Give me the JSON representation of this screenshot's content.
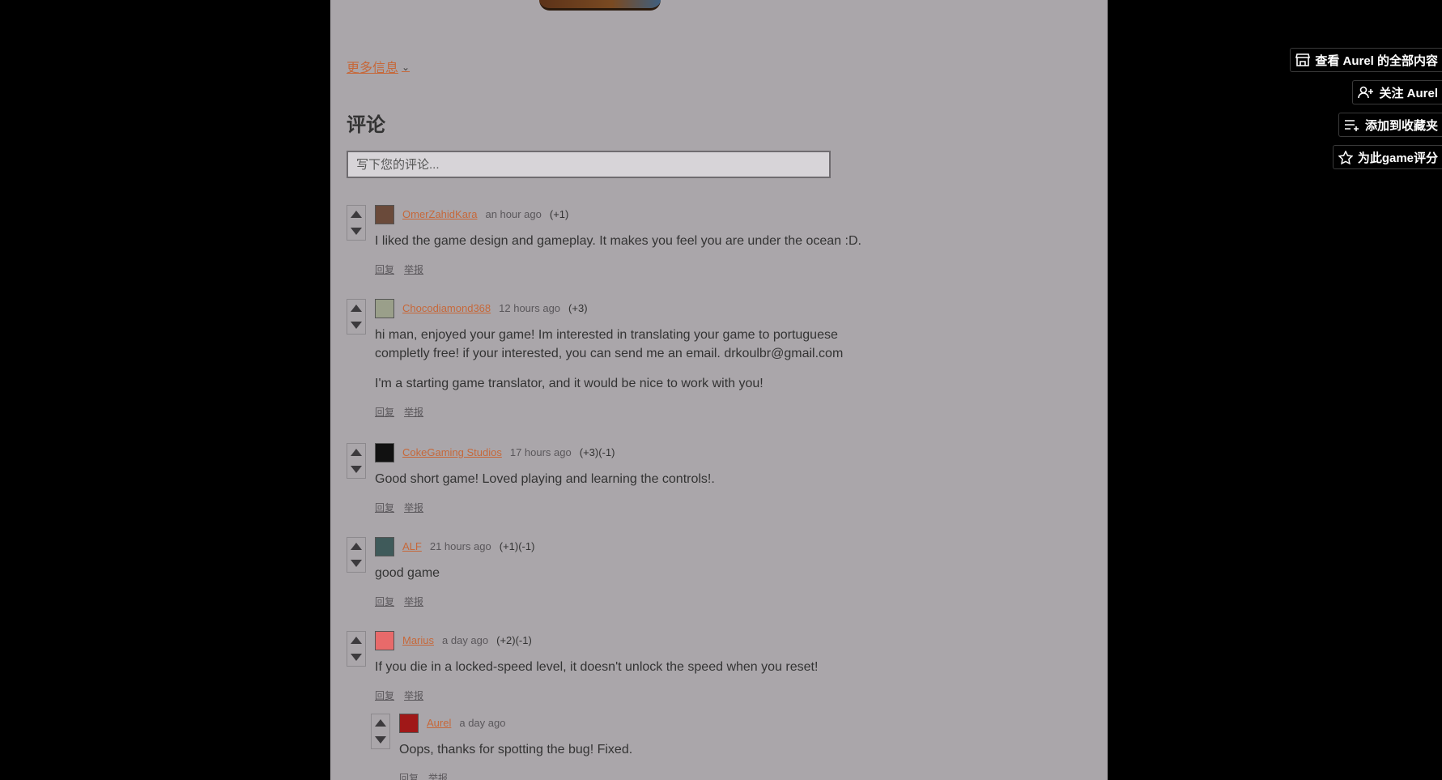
{
  "game": {
    "more_info_label": "更多信息"
  },
  "comments": {
    "title": "评论",
    "input_placeholder": "写下您的评论...",
    "reply_label": "回复",
    "report_label": "举报",
    "items": [
      {
        "author": "OmerZahidKara",
        "time": "an hour ago",
        "votes": "(+1)",
        "paragraphs": [
          "I liked the game design and gameplay. It makes you feel you are under the ocean :D."
        ],
        "avatar_color": "#6a4a3a"
      },
      {
        "author": "Chocodiamond368",
        "time": "12 hours ago",
        "votes": "(+3)",
        "paragraphs": [
          "hi man, enjoyed your game! Im interested in translating your game to portuguese completly free! if your interested, you can send me an email. drkoulbr@gmail.com",
          "I'm a starting game translator, and it would be nice to work with you!"
        ],
        "avatar_color": "#9a9f8a"
      },
      {
        "author": "CokeGaming Studios",
        "time": "17 hours ago",
        "votes": "(+3)(-1)",
        "paragraphs": [
          "Good short game! Loved playing and learning the controls!."
        ],
        "avatar_color": "#111111"
      },
      {
        "author": "ALF",
        "time": "21 hours ago",
        "votes": "(+1)(-1)",
        "paragraphs": [
          "good game"
        ],
        "avatar_color": "#3f5a5a"
      },
      {
        "author": "Marius",
        "time": "a day ago",
        "votes": "(+2)(-1)",
        "paragraphs": [
          "If you die in a locked-speed level, it doesn't unlock the speed when you reset!"
        ],
        "avatar_color": "#e86a6a"
      },
      {
        "author": "Aurel",
        "time": "a day ago",
        "votes": "",
        "paragraphs": [
          "Oops, thanks for spotting the bug! Fixed."
        ],
        "avatar_color": "#a01818"
      }
    ]
  },
  "sidebar": {
    "view_all": "查看 Aurel 的全部内容",
    "follow": "关注 Aurel",
    "add_collection": "添加到收藏夹",
    "rate": "为此game评分"
  }
}
